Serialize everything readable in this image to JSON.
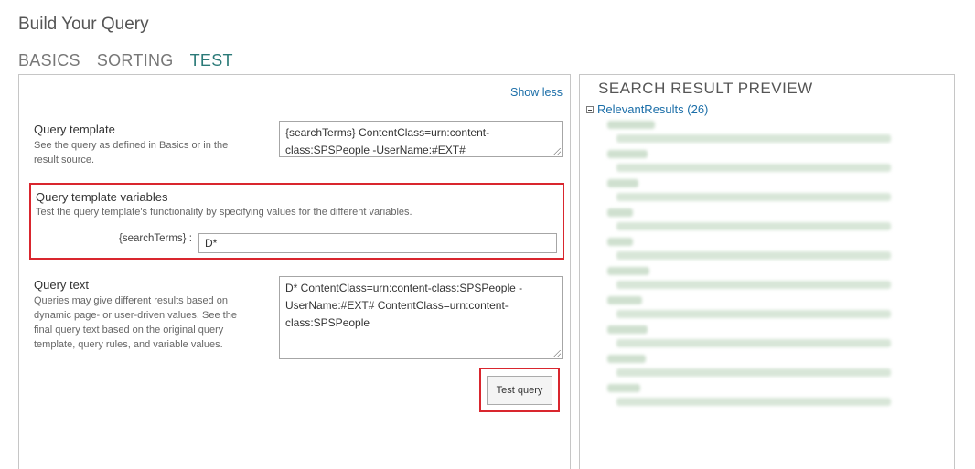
{
  "page": {
    "title": "Build Your Query"
  },
  "tabs": [
    {
      "label": "BASICS",
      "active": false
    },
    {
      "label": "SORTING",
      "active": false
    },
    {
      "label": "TEST",
      "active": true
    }
  ],
  "left": {
    "show_less": "Show less",
    "query_template": {
      "label": "Query template",
      "description": "See the query as defined in Basics or in the result source.",
      "value_line1": "{searchTerms} ContentClass=urn:content-",
      "value_line2": "class:SPSPeople -UserName:#EXT#"
    },
    "variables": {
      "label": "Query template variables",
      "description": "Test the query template's functionality by specifying values for the different variables.",
      "var_name": "{searchTerms} :",
      "var_value": "D*"
    },
    "query_text": {
      "label": "Query text",
      "description": "Queries may give different results based on dynamic page- or user-driven values. See the final query text based on the original query template, query rules, and variable values.",
      "value_line1": "D* ContentClass=urn:content-class:SPSPeople -",
      "value_line2": "UserName:#EXT# ContentClass=urn:content-",
      "value_line3": "class:SPSPeople"
    },
    "test_button": "Test query"
  },
  "right": {
    "title": "SEARCH RESULT PREVIEW",
    "relevant_results": "RelevantResults (26)",
    "blurred_result_count": 10
  },
  "colors": {
    "accent_tab": "#2b7a78",
    "link": "#1b6ea8",
    "highlight": "#d9262e"
  }
}
